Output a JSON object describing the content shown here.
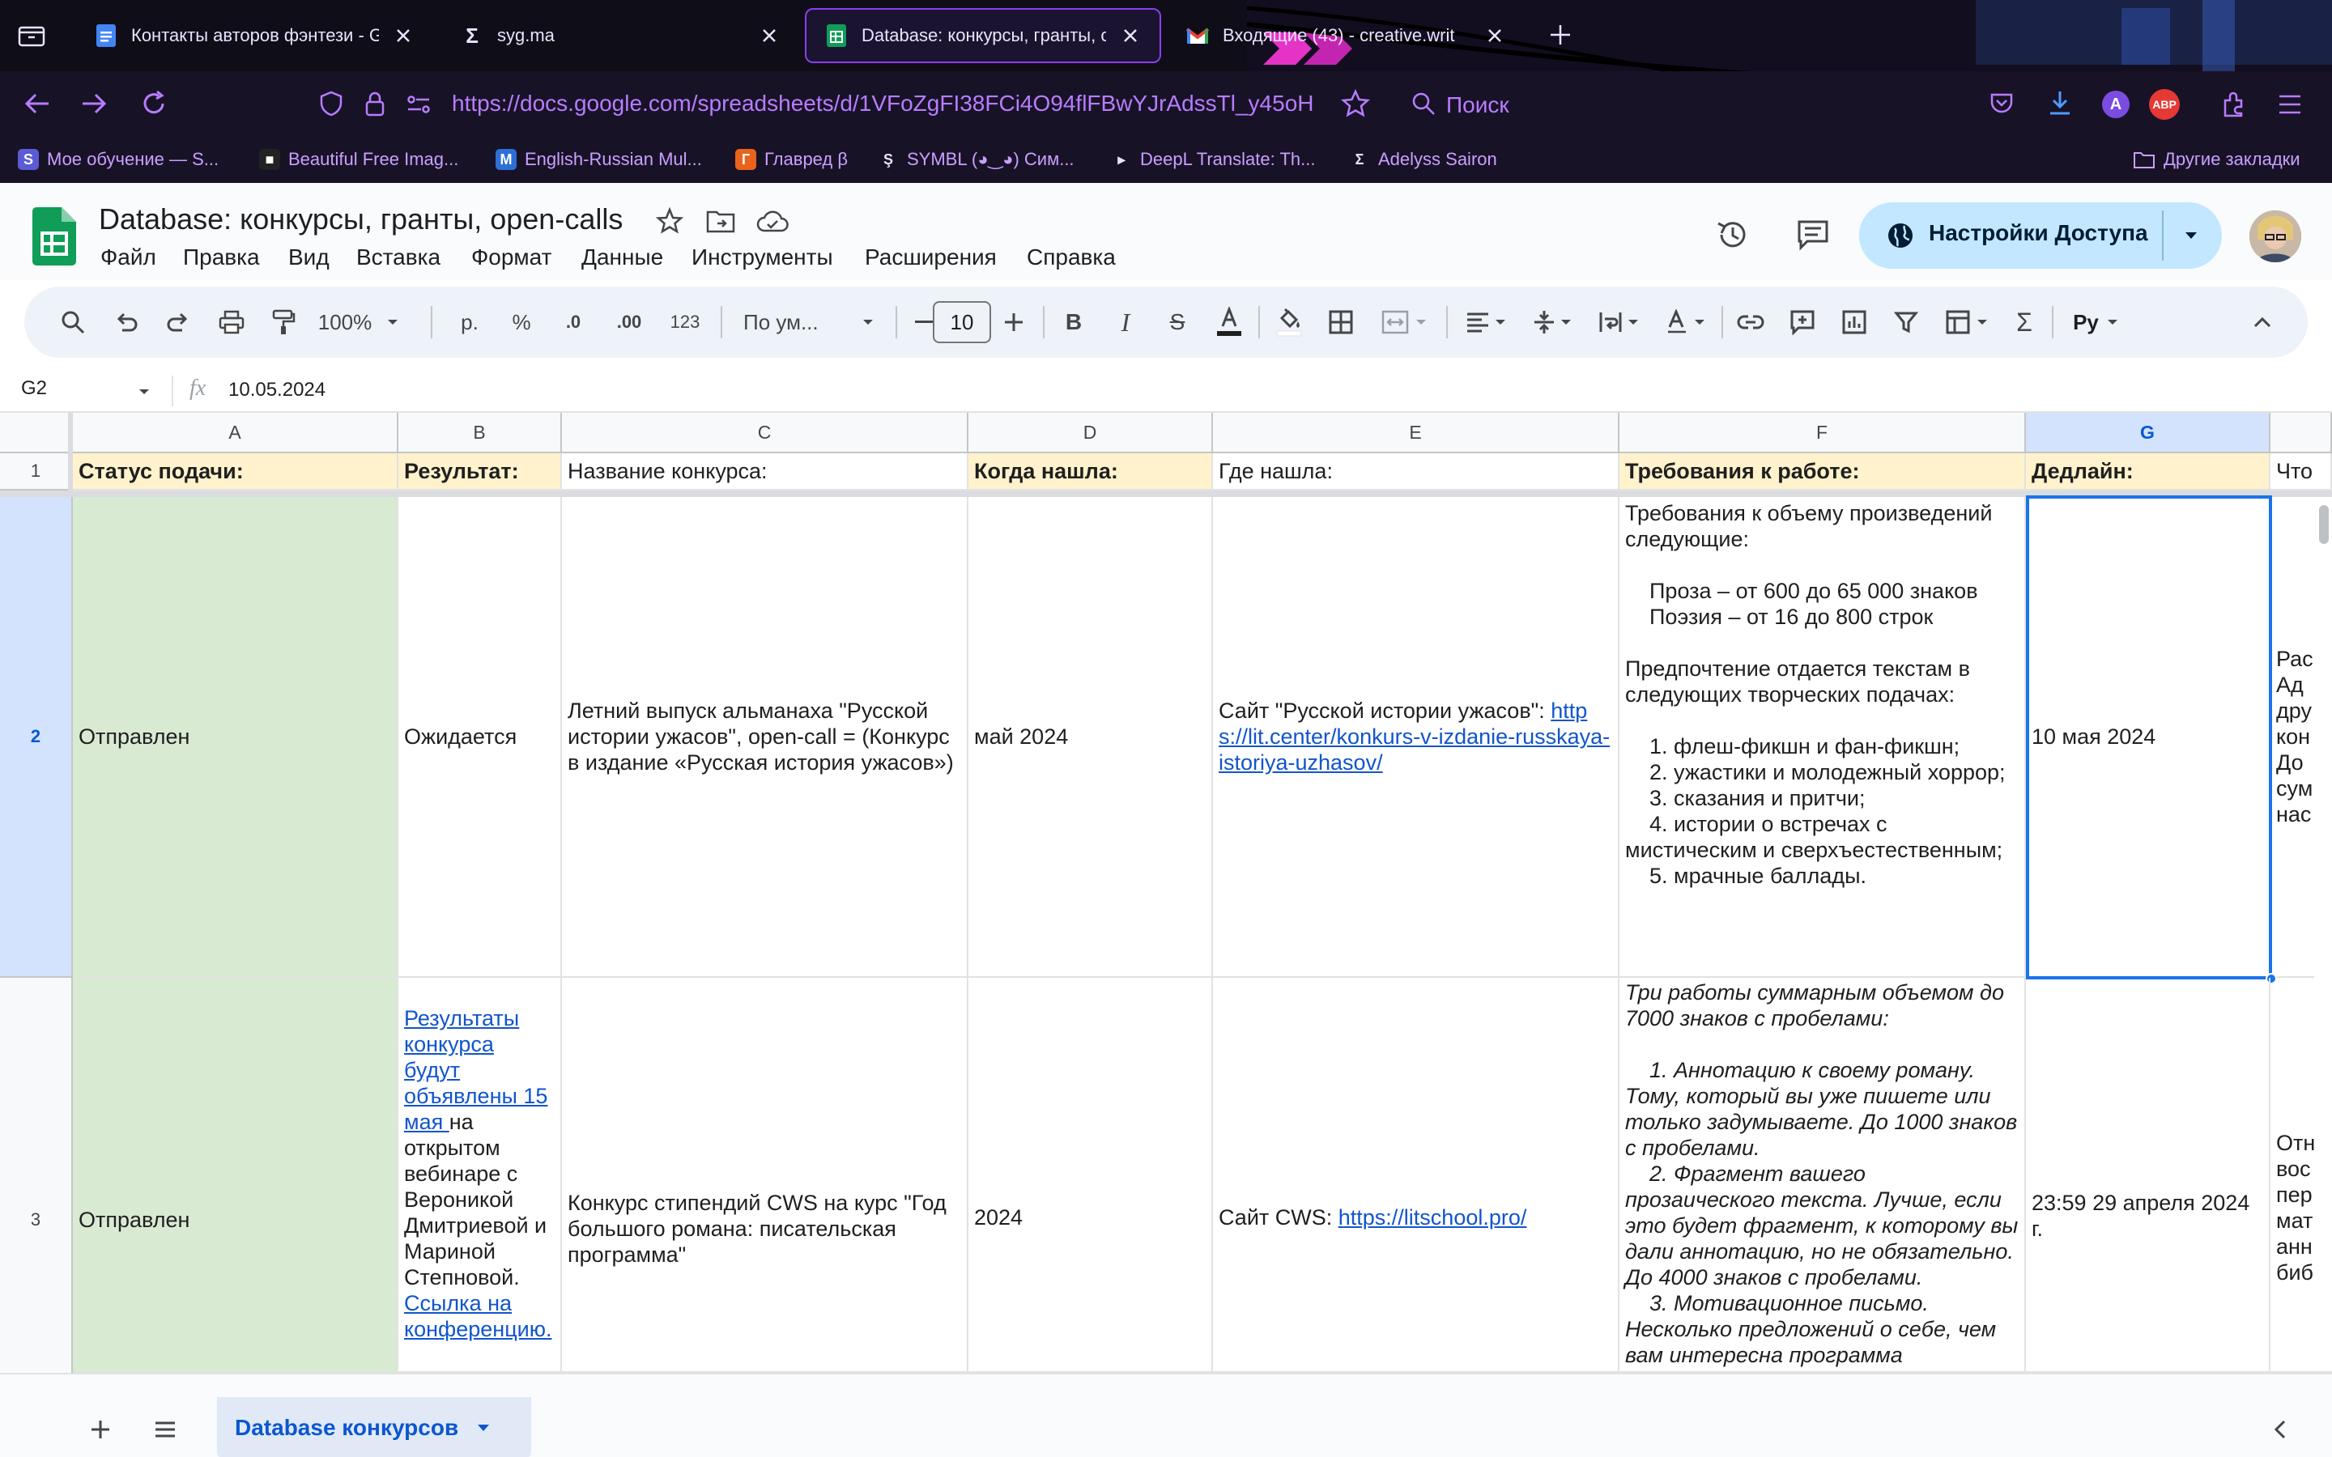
{
  "browser": {
    "tabs": [
      {
        "title": "Контакты авторов фэнтези - G"
      },
      {
        "title": "syg.ma"
      },
      {
        "title": "Database: конкурсы, гранты, о"
      },
      {
        "title": "Входящие (43) - creative.writ"
      }
    ],
    "url": "https://docs.google.com/spreadsheets/d/1VFoZgFI38FCi4O94flFBwYJrAdssTl_y45oH",
    "search_placeholder": "Поиск",
    "bookmarks": [
      {
        "label": "Мое обучение — S...",
        "icon": "S",
        "color": "#5b5bd6"
      },
      {
        "label": "Beautiful Free Imag...",
        "icon": "",
        "color": "#222222"
      },
      {
        "label": "English-Russian Mul...",
        "icon": "M",
        "color": "#2d6fd6"
      },
      {
        "label": "Главред β",
        "icon": "Г",
        "color": "#e8641b"
      },
      {
        "label": "SYMBL (◕‿◕) Сим...",
        "icon": "Ş",
        "color": "#181227"
      },
      {
        "label": "DeepL Translate: Th...",
        "icon": "▸",
        "color": "#181227"
      },
      {
        "label": "Adelyss Sairon",
        "icon": "Σ",
        "color": "#181227"
      }
    ],
    "other_bookmarks": "Другие закладки"
  },
  "sheets": {
    "doc_title": "Database: конкурсы, гранты, open-calls",
    "menu": [
      "Файл",
      "Правка",
      "Вид",
      "Вставка",
      "Формат",
      "Данные",
      "Инструменты",
      "Расширения",
      "Справка"
    ],
    "share_label": "Настройки Доступа",
    "toolbar": {
      "zoom": "100%",
      "currency": "р.",
      "percent": "%",
      "dec_less": ".0",
      "dec_more": ".00",
      "number_format": "123",
      "font": "По ум...",
      "font_size": "10",
      "input_tools": "Ру"
    },
    "name_box": "G2",
    "formula_value": "10.05.2024",
    "columns": [
      "A",
      "B",
      "C",
      "D",
      "E",
      "F",
      "G"
    ],
    "header_row": {
      "a": "Статус подачи:",
      "b": "Результат:",
      "c": "Название конкурса:",
      "d": "Когда нашла:",
      "e": "Где нашла:",
      "f": "Требования к работе:",
      "g": "Дедлайн:",
      "h": "Что"
    },
    "rows": [
      {
        "num": "2",
        "a": "Отправлен",
        "b": "Ожидается",
        "c": "Летний выпуск альманаха \"Русской истории ужасов\", open-call = (Конкурс в издание «Русская история ужасов»)",
        "d": "май 2024",
        "e_prefix": "Сайт \"Русской истории ужасов\": ",
        "e_link": "https://lit.center/konkurs-v-izdanie-russkaya-istoriya-uzhasov/",
        "f": "Требования к объему произведений следующие:\n\n    Проза – от 600 до 65 000 знаков\n    Поэзия – от 16 до 800 строк\n\nПредпочтение отдается текстам в следующих творческих подачах:\n\n    1. флеш-фикшн и фан-фикшн;\n    2. ужастики и молодежный хоррор;\n    3. сказания и притчи;\n    4. истории о встречах с мистическим и сверхъестественным;\n    5. мрачные баллады.",
        "g": "10 мая 2024",
        "h": "Рас\nАд\nдру\nкон\nДо\nсум\nнас"
      },
      {
        "num": "3",
        "a": "Отправлен",
        "b_link1": "Результаты конкурса будут объявлены 15 мая ",
        "b_text": "на открытом вебинаре с Вероникой Дмитриевой и Мариной Степновой.",
        "b_link2": "Ссылка на конференцию.",
        "c": "Конкурс стипендий CWS на курс \"Год большого романа: писательская программа\"",
        "d": "2024",
        "e_prefix": "Сайт CWS: ",
        "e_link": "https://litschool.pro/",
        "f": "Три работы суммарным объемом до 7000 знаков с пробелами:\n\n    1. Аннотацию к своему роману. Тому, который вы уже пишете или только задумываете. До 1000 знаков с пробелами.\n    2. Фрагмент вашего прозаического текста. Лучше, если это будет фрагмент, к которому вы дали аннотацию, но не обязательно. До 4000 знаков с пробелами.\n    3. Мотивационное письмо. Несколько предложений о себе, чем вам интересна программа",
        "g": "23:59 29 апреля 2024 г.",
        "h": "Отн\nвос\nпер\nмат\nанн\nбиб"
      }
    ],
    "sheet_tab": "Database конкурсов",
    "colors": {
      "status_fill": "#d9ead3",
      "header_fill": "#fff2cc",
      "selection": "#1a73e8",
      "link": "#1155cc"
    }
  }
}
